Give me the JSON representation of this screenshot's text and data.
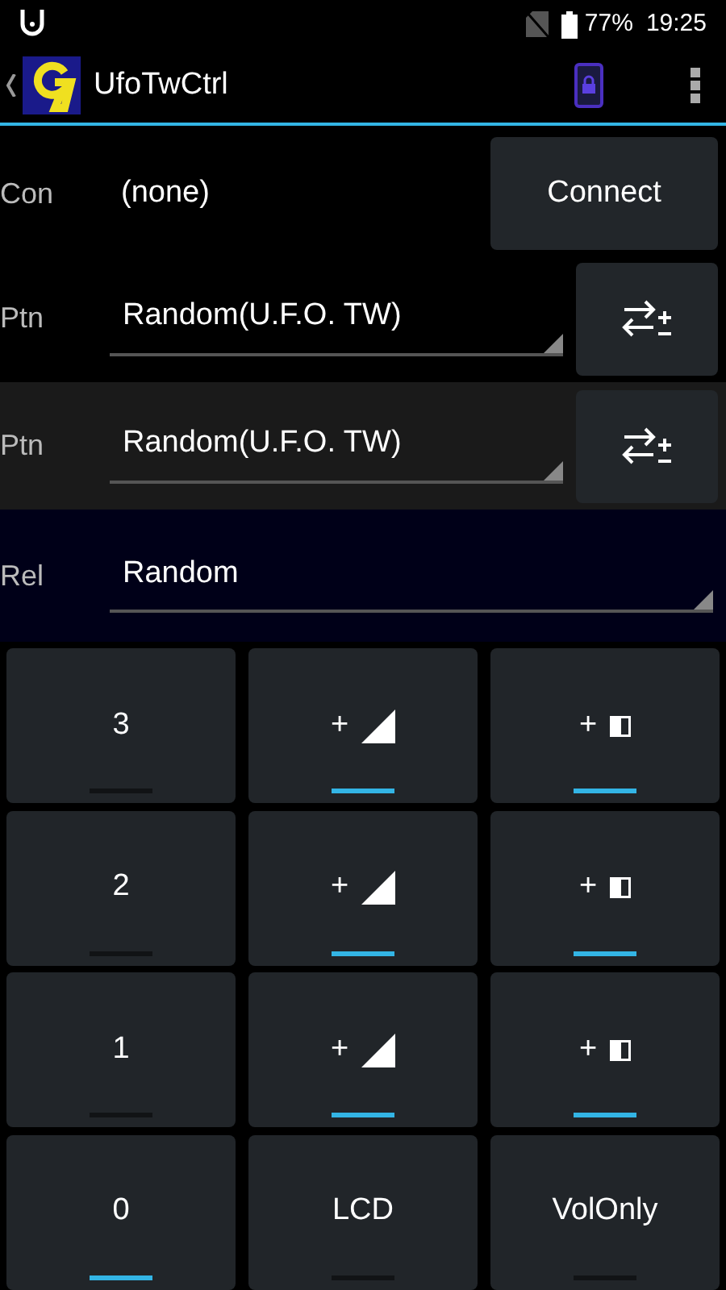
{
  "status_bar": {
    "battery": "77%",
    "time": "19:25"
  },
  "action_bar": {
    "title": "UfoTwCtrl"
  },
  "connection": {
    "label": "Con",
    "value": "(none)",
    "button": "Connect"
  },
  "patterns": [
    {
      "label": "Ptn",
      "value": "Random(U.F.O. TW)",
      "highlighted": false
    },
    {
      "label": "Ptn",
      "value": "Random(U.F.O. TW)",
      "highlighted": true
    }
  ],
  "relation": {
    "label": "Rel",
    "value": "Random"
  },
  "grid": [
    [
      {
        "kind": "text",
        "label": "3",
        "on": false
      },
      {
        "kind": "signal",
        "label": "+",
        "on": true
      },
      {
        "kind": "contrast",
        "label": "+",
        "on": true
      }
    ],
    [
      {
        "kind": "text",
        "label": "2",
        "on": false
      },
      {
        "kind": "signal",
        "label": "+",
        "on": true
      },
      {
        "kind": "contrast",
        "label": "+",
        "on": true
      }
    ],
    [
      {
        "kind": "text",
        "label": "1",
        "on": false
      },
      {
        "kind": "signal",
        "label": "+",
        "on": true
      },
      {
        "kind": "contrast",
        "label": "+",
        "on": true
      }
    ],
    [
      {
        "kind": "text",
        "label": "0",
        "on": true
      },
      {
        "kind": "text",
        "label": "LCD",
        "on": false
      },
      {
        "kind": "text",
        "label": "VolOnly",
        "on": false
      }
    ]
  ]
}
